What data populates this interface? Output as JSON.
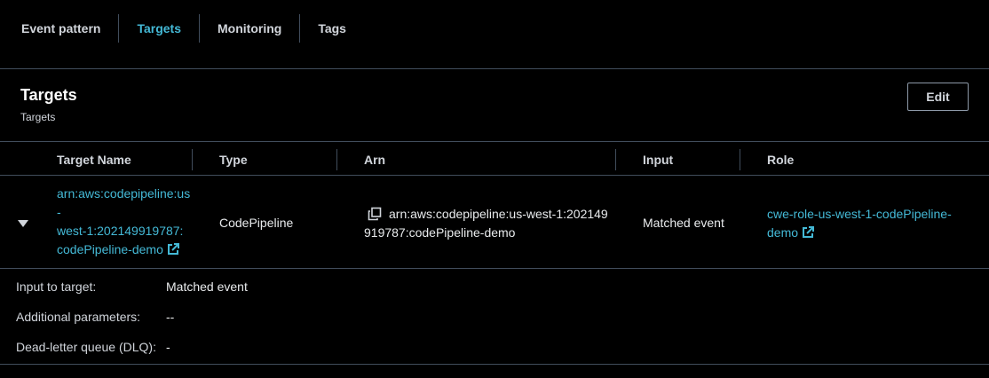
{
  "tabs": [
    {
      "label": "Event pattern"
    },
    {
      "label": "Targets"
    },
    {
      "label": "Monitoring"
    },
    {
      "label": "Tags"
    }
  ],
  "active_tab": "Targets",
  "panel": {
    "title": "Targets",
    "subtitle": "Targets",
    "edit_label": "Edit"
  },
  "table": {
    "columns": [
      "Target Name",
      "Type",
      "Arn",
      "Input",
      "Role"
    ],
    "row": {
      "target_name_lines": [
        "arn:aws:codepipeline:us",
        "-",
        "west-1:202149919787:",
        "codePipeline-demo"
      ],
      "type": "CodePipeline",
      "arn_lines": [
        "arn:aws:codepipeline:us-west-1:202149",
        "919787:codePipeline-demo"
      ],
      "input": "Matched event",
      "role_lines": [
        "cwe-role-us-west-1-codePipeline-",
        "demo"
      ]
    }
  },
  "details": [
    {
      "label": "Input to target:",
      "value": "Matched event"
    },
    {
      "label": "Additional parameters:",
      "value": "--"
    },
    {
      "label": "Dead-letter queue (DLQ):",
      "value": "-"
    }
  ],
  "colors": {
    "background": "#000000",
    "link": "#44b9d6",
    "divider": "#414d5c",
    "text": "#e9ebed"
  }
}
